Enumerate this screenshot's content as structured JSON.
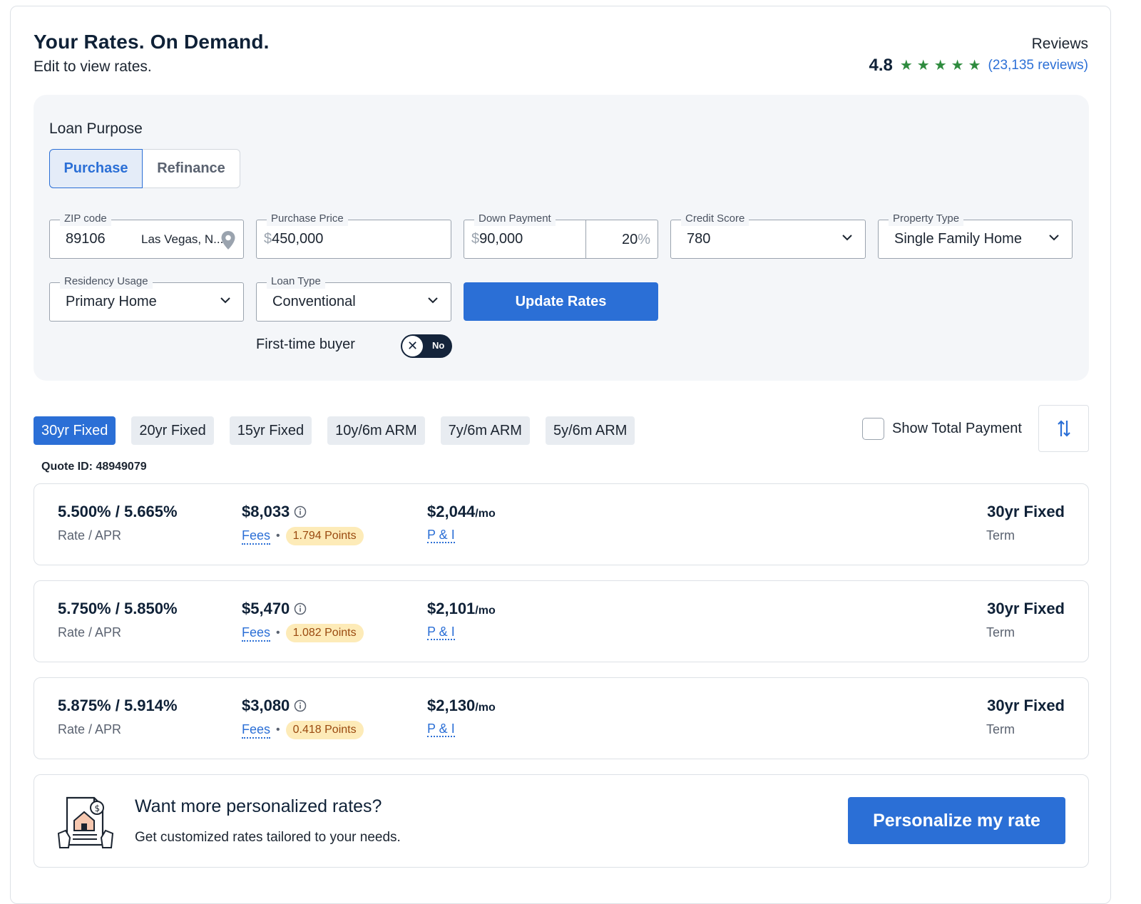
{
  "header": {
    "title": "Your Rates. On Demand.",
    "subtitle": "Edit to view rates."
  },
  "reviews": {
    "heading": "Reviews",
    "score": "4.8",
    "stars": 5,
    "count_link": "(23,135 reviews)",
    "star_color": "#2e8b3e"
  },
  "form": {
    "loan_purpose_label": "Loan Purpose",
    "purpose_options": [
      "Purchase",
      "Refinance"
    ],
    "purpose_selected": "Purchase",
    "zip": {
      "label": "ZIP code",
      "value": "89106",
      "city": "Las Vegas, N...",
      "icon": "location-pin-icon"
    },
    "purchase_price": {
      "label": "Purchase Price",
      "currency": "$",
      "value": "450,000"
    },
    "down_payment": {
      "label": "Down Payment",
      "currency": "$",
      "value": "90,000",
      "percent": "20",
      "percent_sign": "%"
    },
    "credit_score": {
      "label": "Credit Score",
      "value": "780"
    },
    "property_type": {
      "label": "Property Type",
      "value": "Single Family Home"
    },
    "residency_usage": {
      "label": "Residency Usage",
      "value": "Primary Home"
    },
    "loan_type": {
      "label": "Loan Type",
      "value": "Conventional"
    },
    "update_button": "Update Rates",
    "first_time_buyer": {
      "label": "First-time buyer",
      "toggle_text": "No",
      "toggle_icon": "close-x-icon",
      "on": false
    }
  },
  "tabs": {
    "items": [
      "30yr Fixed",
      "20yr Fixed",
      "15yr Fixed",
      "10y/6m ARM",
      "7y/6m ARM",
      "5y/6m ARM"
    ],
    "active": "30yr Fixed"
  },
  "show_total_payment": {
    "label": "Show Total Payment",
    "checked": false
  },
  "sort_icon": "sort-arrows-icon",
  "quote_id": "Quote ID: 48949079",
  "rates": [
    {
      "rate_apr": "5.500% / 5.665%",
      "rate_label": "Rate / APR",
      "fees": "$8,033",
      "fees_label": "Fees",
      "points": "1.794 Points",
      "payment": "$2,044",
      "per": "/mo",
      "pi_label": "P & I",
      "term": "30yr Fixed",
      "term_label": "Term"
    },
    {
      "rate_apr": "5.750% / 5.850%",
      "rate_label": "Rate / APR",
      "fees": "$5,470",
      "fees_label": "Fees",
      "points": "1.082 Points",
      "payment": "$2,101",
      "per": "/mo",
      "pi_label": "P & I",
      "term": "30yr Fixed",
      "term_label": "Term"
    },
    {
      "rate_apr": "5.875% / 5.914%",
      "rate_label": "Rate / APR",
      "fees": "$3,080",
      "fees_label": "Fees",
      "points": "0.418 Points",
      "payment": "$2,130",
      "per": "/mo",
      "pi_label": "P & I",
      "term": "30yr Fixed",
      "term_label": "Term"
    }
  ],
  "promo": {
    "icon": "document-house-icon",
    "title": "Want more personalized rates?",
    "subtitle": "Get customized rates tailored to your needs.",
    "button": "Personalize my rate"
  },
  "colors": {
    "accent": "#2b6fd6",
    "navy": "#0f2137",
    "points_bg": "#fdebb8",
    "points_text": "#9a4a10",
    "panel_bg": "#f4f6f9"
  }
}
